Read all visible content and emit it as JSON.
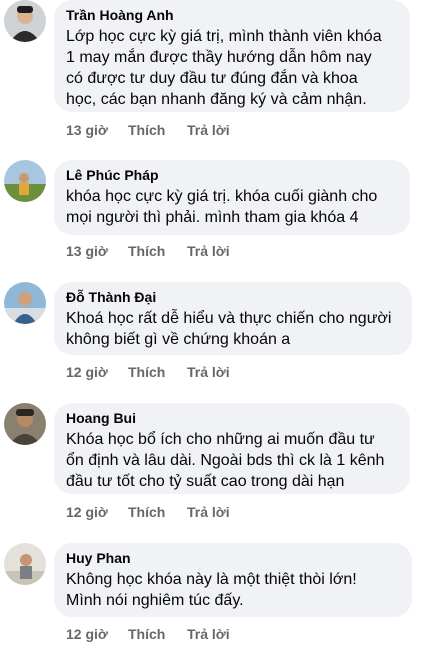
{
  "comments": [
    {
      "author": "Trần Hoàng Anh",
      "text": "Lớp học cực kỳ giá trị, mình thành viên khóa\n1 may mắn được thầy hướng dẫn hôm nay\ncó được tư duy đầu tư đúng đắn và khoa\nhọc, các bạn nhanh đăng ký và cảm nhận.",
      "time": "13 giờ",
      "like": "Thích",
      "reply": "Trả lời",
      "avatar_color": "#2b2b2b"
    },
    {
      "author": "Lê Phúc Pháp",
      "text": "khóa học cực kỳ giá trị. khóa cuối giành cho\nmọi người thì phải. mình tham gia khóa 4",
      "time": "13 giờ",
      "like": "Thích",
      "reply": "Trả lời",
      "avatar_color": "#6b8f3a"
    },
    {
      "author": "Đỗ Thành Đại",
      "text": "Khoá học rất dễ hiểu và thực chiến cho người\nkhông biết gì về chứng khoán a",
      "time": "12 giờ",
      "like": "Thích",
      "reply": "Trả lời",
      "avatar_color": "#8fb8d8"
    },
    {
      "author": "Hoang Bui",
      "text": "Khóa học bổ ích cho những ai muốn đầu tư\nổn định và lâu dài. Ngoài bds thì ck là 1 kênh\nđầu tư tốt cho tỷ suất cao trong dài hạn",
      "time": "12 giờ",
      "like": "Thích",
      "reply": "Trả lời",
      "avatar_color": "#4a4236"
    },
    {
      "author": "Huy Phan",
      "text": "Không học khóa này là một thiệt thòi lớn!\nMình nói nghiêm túc đấy.",
      "time": "12 giờ",
      "like": "Thích",
      "reply": "Trả lời",
      "avatar_color": "#c9c3b8"
    }
  ]
}
